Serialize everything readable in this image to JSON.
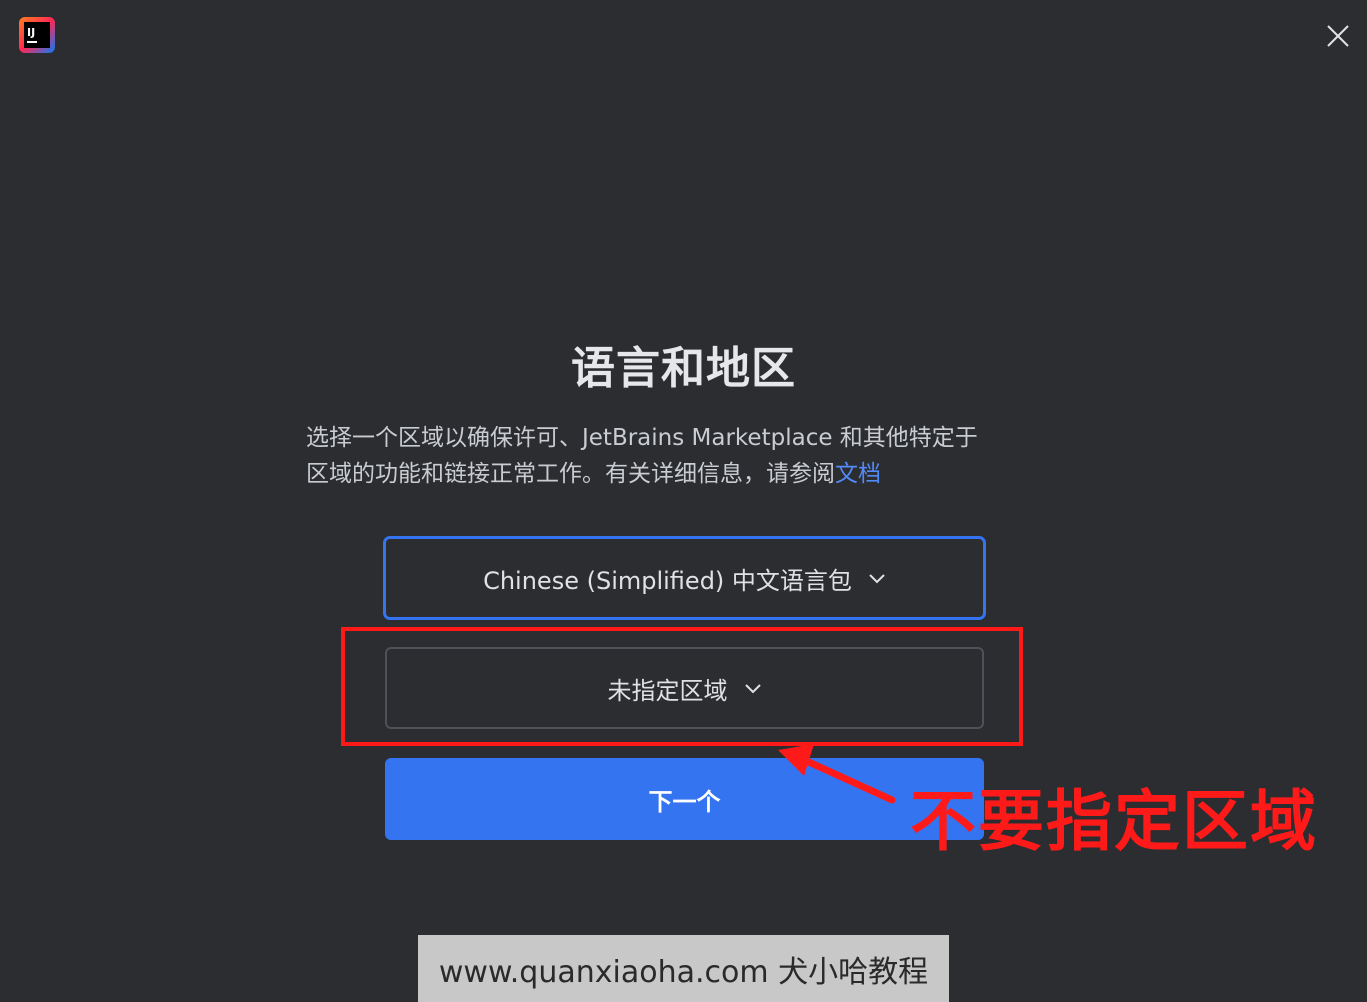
{
  "window": {
    "logo_icon": "intellij-idea-logo",
    "close_icon": "close-icon"
  },
  "main": {
    "title": "语言和地区",
    "description_line1": "选择一个区域以确保许可、JetBrains Marketplace 和其他特定于",
    "description_line2": "区域的功能和链接正常工作。有关详细信息，请参阅",
    "doc_link": "文档",
    "language_select": {
      "value": "Chinese (Simplified) 中文语言包",
      "icon": "chevron-down-icon"
    },
    "region_select": {
      "value": "未指定区域",
      "icon": "chevron-down-icon"
    },
    "next_button": "下一个"
  },
  "annotation": {
    "text": "不要指定区域",
    "color": "#ff1a1a"
  },
  "watermark": {
    "text": "www.quanxiaoha.com 犬小哈教程"
  },
  "colors": {
    "background": "#2b2d30",
    "accent": "#3574f0",
    "link": "#548af7"
  }
}
